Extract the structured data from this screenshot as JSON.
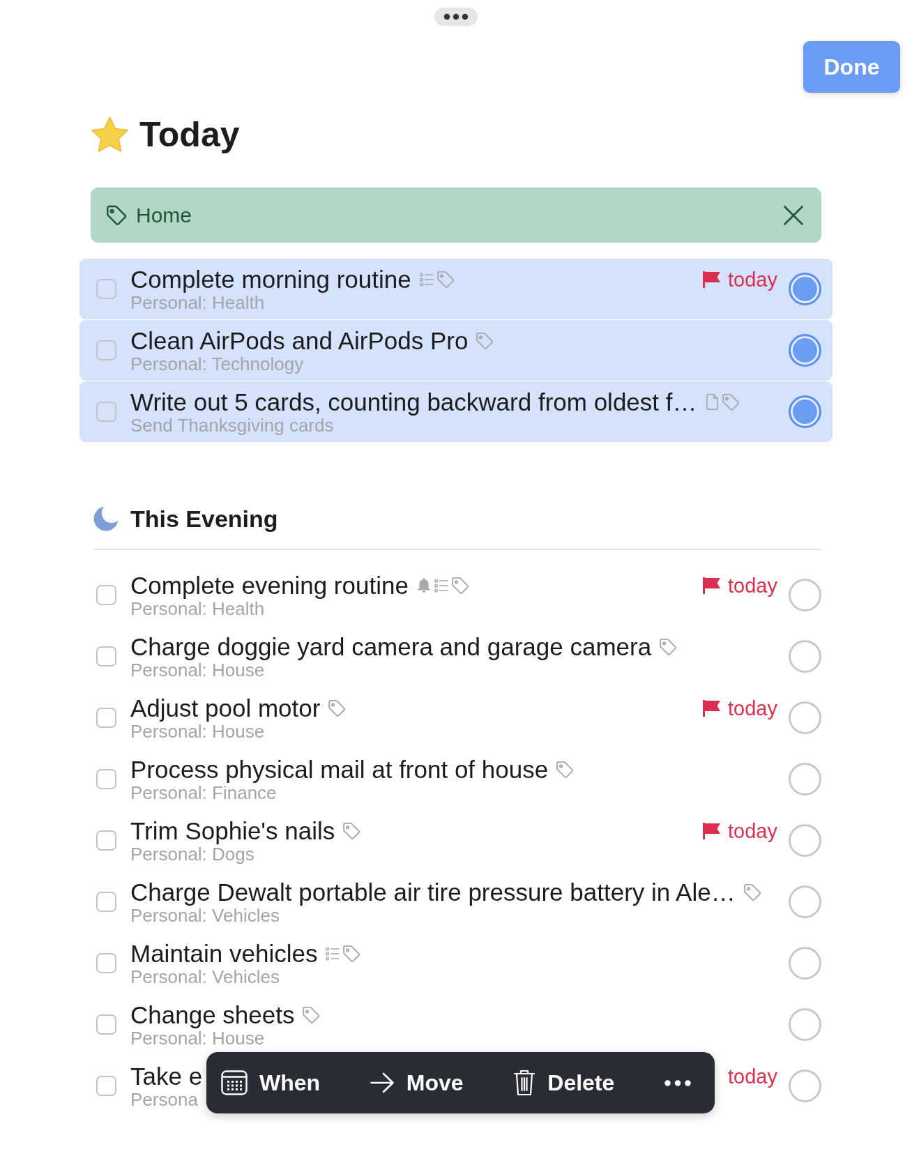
{
  "done_button": "Done",
  "today": {
    "title": "Today",
    "filter": {
      "label": "Home"
    },
    "tasks": [
      {
        "title": "Complete morning routine",
        "subtitle": "Personal: Health",
        "reminder": false,
        "notes": false,
        "checklist": true,
        "tags": true,
        "due": "today",
        "flag": true,
        "checked": false,
        "selected": true
      },
      {
        "title": "Clean AirPods and AirPods Pro",
        "subtitle": "Personal: Technology",
        "reminder": false,
        "notes": false,
        "checklist": false,
        "tags": true,
        "checked": false,
        "selected": true
      },
      {
        "title": "Write out 5 cards, counting backward from oldest f…",
        "subtitle": "Send Thanksgiving cards",
        "reminder": false,
        "notes": true,
        "checklist": false,
        "tags": true,
        "checked": false,
        "selected": true
      }
    ]
  },
  "evening": {
    "title": "This Evening",
    "tasks": [
      {
        "title": "Complete evening routine",
        "subtitle": "Personal: Health",
        "reminder": true,
        "notes": false,
        "checklist": true,
        "tags": true,
        "due": "today",
        "flag": true,
        "checked": false,
        "selected": false
      },
      {
        "title": "Charge doggie yard camera and garage camera",
        "subtitle": "Personal: House",
        "reminder": false,
        "notes": false,
        "checklist": false,
        "tags": true,
        "checked": false,
        "selected": false
      },
      {
        "title": "Adjust pool motor",
        "subtitle": "Personal: House",
        "reminder": false,
        "notes": false,
        "checklist": false,
        "tags": true,
        "due": "today",
        "flag": true,
        "checked": false,
        "selected": false
      },
      {
        "title": "Process physical mail at front of house",
        "subtitle": "Personal: Finance",
        "reminder": false,
        "notes": false,
        "checklist": false,
        "tags": true,
        "checked": false,
        "selected": false
      },
      {
        "title": "Trim Sophie's nails",
        "subtitle": "Personal: Dogs",
        "reminder": false,
        "notes": false,
        "checklist": false,
        "tags": true,
        "due": "today",
        "flag": true,
        "checked": false,
        "selected": false
      },
      {
        "title": "Charge Dewalt portable air tire pressure battery in Ale…",
        "subtitle": "Personal: Vehicles",
        "reminder": false,
        "notes": false,
        "checklist": false,
        "tags": true,
        "checked": false,
        "selected": false
      },
      {
        "title": "Maintain vehicles",
        "subtitle": "Personal: Vehicles",
        "reminder": false,
        "notes": false,
        "checklist": true,
        "tags": true,
        "checked": false,
        "selected": false
      },
      {
        "title": "Change sheets",
        "subtitle": "Personal: House",
        "reminder": false,
        "notes": false,
        "checklist": false,
        "tags": true,
        "checked": false,
        "selected": false
      },
      {
        "title": "Take e",
        "subtitle": "Persona",
        "reminder": false,
        "notes": false,
        "checklist": false,
        "tags": false,
        "due": "today",
        "flag": false,
        "checked": false,
        "selected": false
      }
    ]
  },
  "action_bar": [
    {
      "kind": "when",
      "label": "When"
    },
    {
      "kind": "move",
      "label": "Move"
    },
    {
      "kind": "delete",
      "label": "Delete"
    },
    {
      "kind": "more"
    }
  ]
}
